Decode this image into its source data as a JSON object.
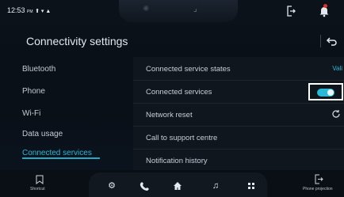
{
  "status_bar": {
    "time": "12:53",
    "ampm": "PM",
    "indicators": "⬆ ▾ ▲"
  },
  "header": {
    "title": "Connectivity settings"
  },
  "sidebar": {
    "items": [
      {
        "label": "Bluetooth",
        "active": false
      },
      {
        "label": "Phone",
        "active": false
      },
      {
        "label": "Wi-Fi",
        "active": false
      },
      {
        "label": "Data usage",
        "active": false
      },
      {
        "label": "Connected services",
        "active": true
      }
    ]
  },
  "settings": {
    "rows": [
      {
        "label": "Connected service states",
        "value": "Vali"
      },
      {
        "label": "Connected services",
        "toggle": true
      },
      {
        "label": "Network reset"
      },
      {
        "label": "Call to support centre"
      },
      {
        "label": "Notification history"
      }
    ]
  },
  "dock": {
    "shortcut_label": "Shortcut",
    "phone_projection_label": "Phone projection"
  },
  "colors": {
    "accent": "#29b8d6",
    "notification_dot": "#e0312d"
  }
}
